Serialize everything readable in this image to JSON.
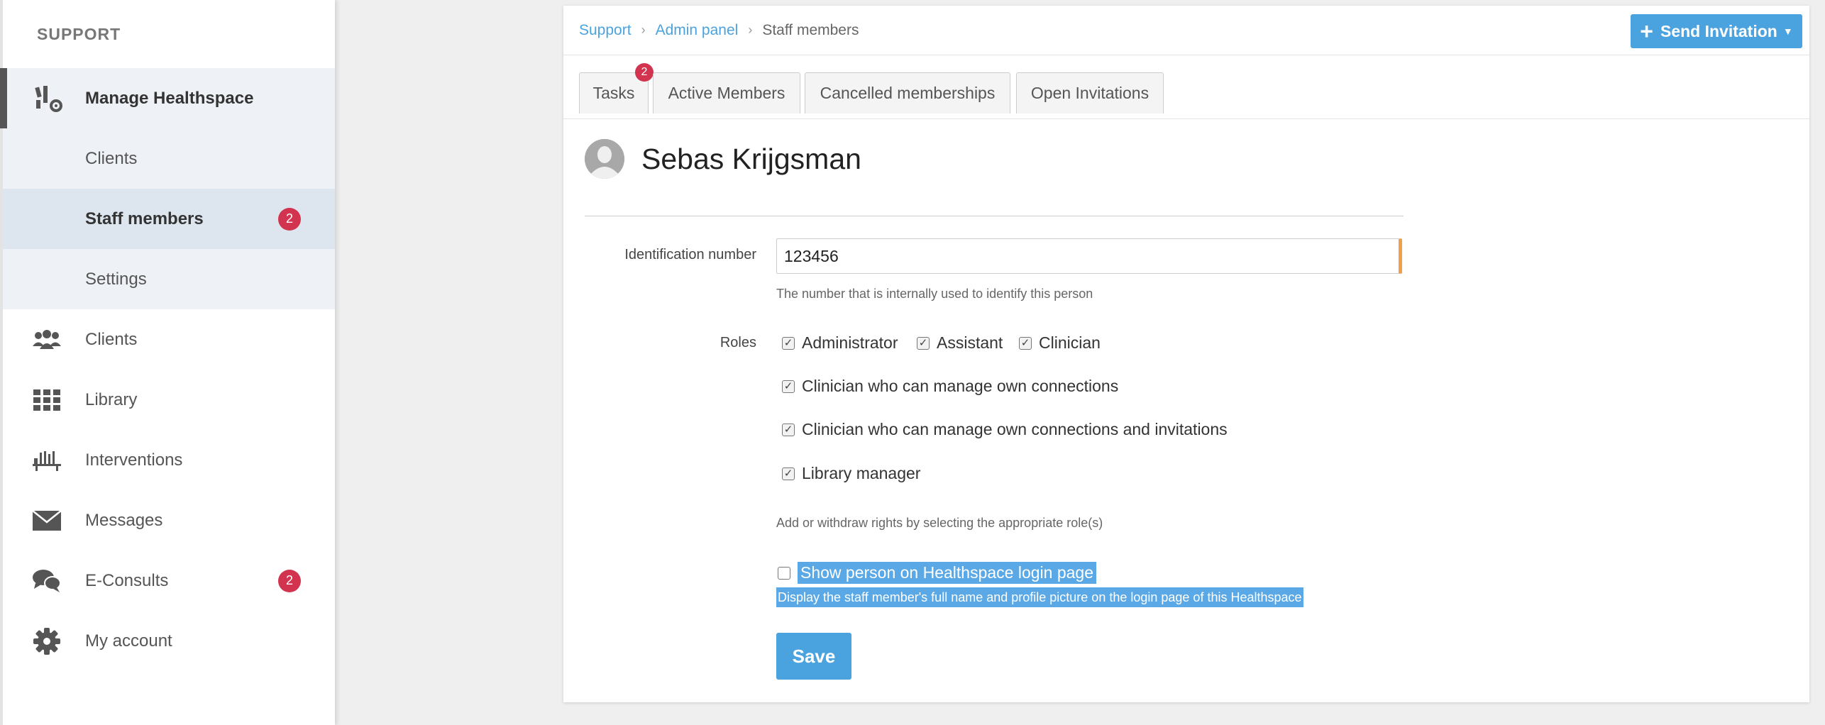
{
  "sidebar": {
    "header": "SUPPORT",
    "main_item": {
      "label": "Manage Healthspace",
      "icon": "manage-healthspace-icon"
    },
    "sub_items": [
      {
        "label": "Clients"
      },
      {
        "label": "Staff members",
        "badge": "2"
      },
      {
        "label": "Settings"
      }
    ],
    "items": [
      {
        "label": "Clients",
        "icon": "clients-icon"
      },
      {
        "label": "Library",
        "icon": "library-icon"
      },
      {
        "label": "Interventions",
        "icon": "interventions-icon"
      },
      {
        "label": "Messages",
        "icon": "envelope-icon"
      },
      {
        "label": "E-Consults",
        "icon": "chat-icon",
        "badge": "2"
      },
      {
        "label": "My account",
        "icon": "gear-icon"
      }
    ]
  },
  "breadcrumb": {
    "items": [
      "Support",
      "Admin panel"
    ],
    "current": "Staff members"
  },
  "send_invitation": {
    "label": "Send Invitation"
  },
  "tabs": [
    {
      "label": "Tasks",
      "badge": "2"
    },
    {
      "label": "Active Members"
    },
    {
      "label": "Cancelled memberships"
    },
    {
      "label": "Open Invitations"
    }
  ],
  "person": {
    "name": "Sebas Krijgsman"
  },
  "form": {
    "id_label": "Identification number",
    "id_value": "123456",
    "id_help": "The number that is internally used to identify this person",
    "roles_label": "Roles",
    "roles": [
      {
        "label": "Administrator",
        "checked": true
      },
      {
        "label": "Assistant",
        "checked": true
      },
      {
        "label": "Clinician",
        "checked": true
      },
      {
        "label": "Clinician who can manage own connections",
        "checked": true
      },
      {
        "label": "Clinician who can manage own connections and invitations",
        "checked": true
      },
      {
        "label": "Library manager",
        "checked": true
      }
    ],
    "roles_help": "Add or withdraw rights by selecting the appropriate role(s)",
    "show_login_label": "Show person on Healthspace login page",
    "show_login_checked": false,
    "show_login_help": "Display the staff member's full name and profile picture on the login page of this Healthspace",
    "save_label": "Save"
  },
  "colors": {
    "accent": "#4aa3df",
    "badge": "#d2334e",
    "highlight": "#5aa9e6"
  }
}
